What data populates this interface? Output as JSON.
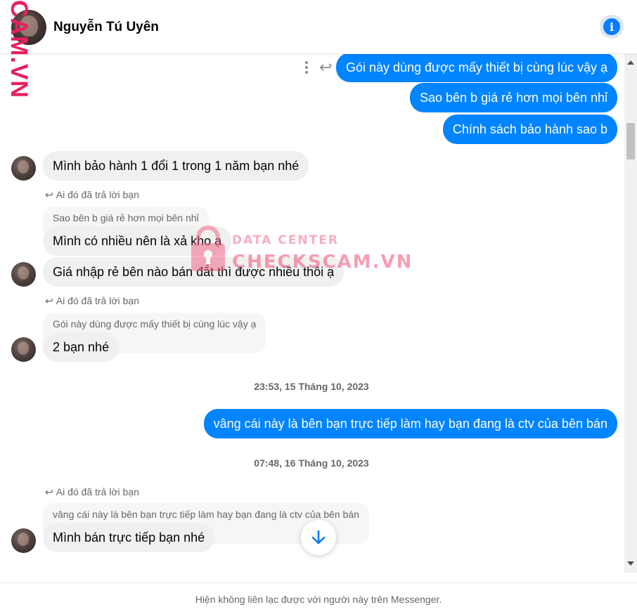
{
  "header": {
    "contact_name": "Nguyễn Tú Uyên",
    "info_icon": "info-icon"
  },
  "watermark": {
    "side_text": "CAM.VN",
    "center_line1": "DATA CENTER",
    "center_line2": "CHECKSCAM.VN"
  },
  "messages": {
    "out1": "Gói này dùng được mấy thiết bị cùng lúc vậy ạ",
    "out2": "Sao bên b giá rẻ hơn mọi bên nhỉ",
    "out3": "Chính sách bảo hành sao b",
    "in1": "Mình bảo hành 1 đổi 1 trong 1 năm bạn nhé",
    "reply_note1": "Ai đó đã trả lời bạn",
    "quote1": "Sao bên b giá rẻ hơn mọi bên nhỉ",
    "in2": "Mình có nhiều nên là xả kho ạ",
    "in3": "Giá nhập rẻ bên nào bán đắt thì được nhiều thôi ạ",
    "reply_note2": "Ai đó đã trả lời bạn",
    "quote2": "Gói này dùng được mấy thiết bị cùng lúc vậy ạ",
    "in4": "2 bạn nhé",
    "timestamp1": "23:53, 15 Tháng 10, 2023",
    "out4": "vâng cái này là bên bạn trực tiếp làm hay bạn đang là ctv của bên bán",
    "timestamp2": "07:48, 16 Tháng 10, 2023",
    "reply_note3": "Ai đó đã trả lời bạn",
    "quote3": "vâng cái này là bên bạn trực tiếp làm hay bạn đang là ctv của bên bán",
    "in5": "Mình bán trực tiếp bạn nhé"
  },
  "footer": {
    "notice": "Hiện không liên lạc được với người này trên Messenger."
  }
}
